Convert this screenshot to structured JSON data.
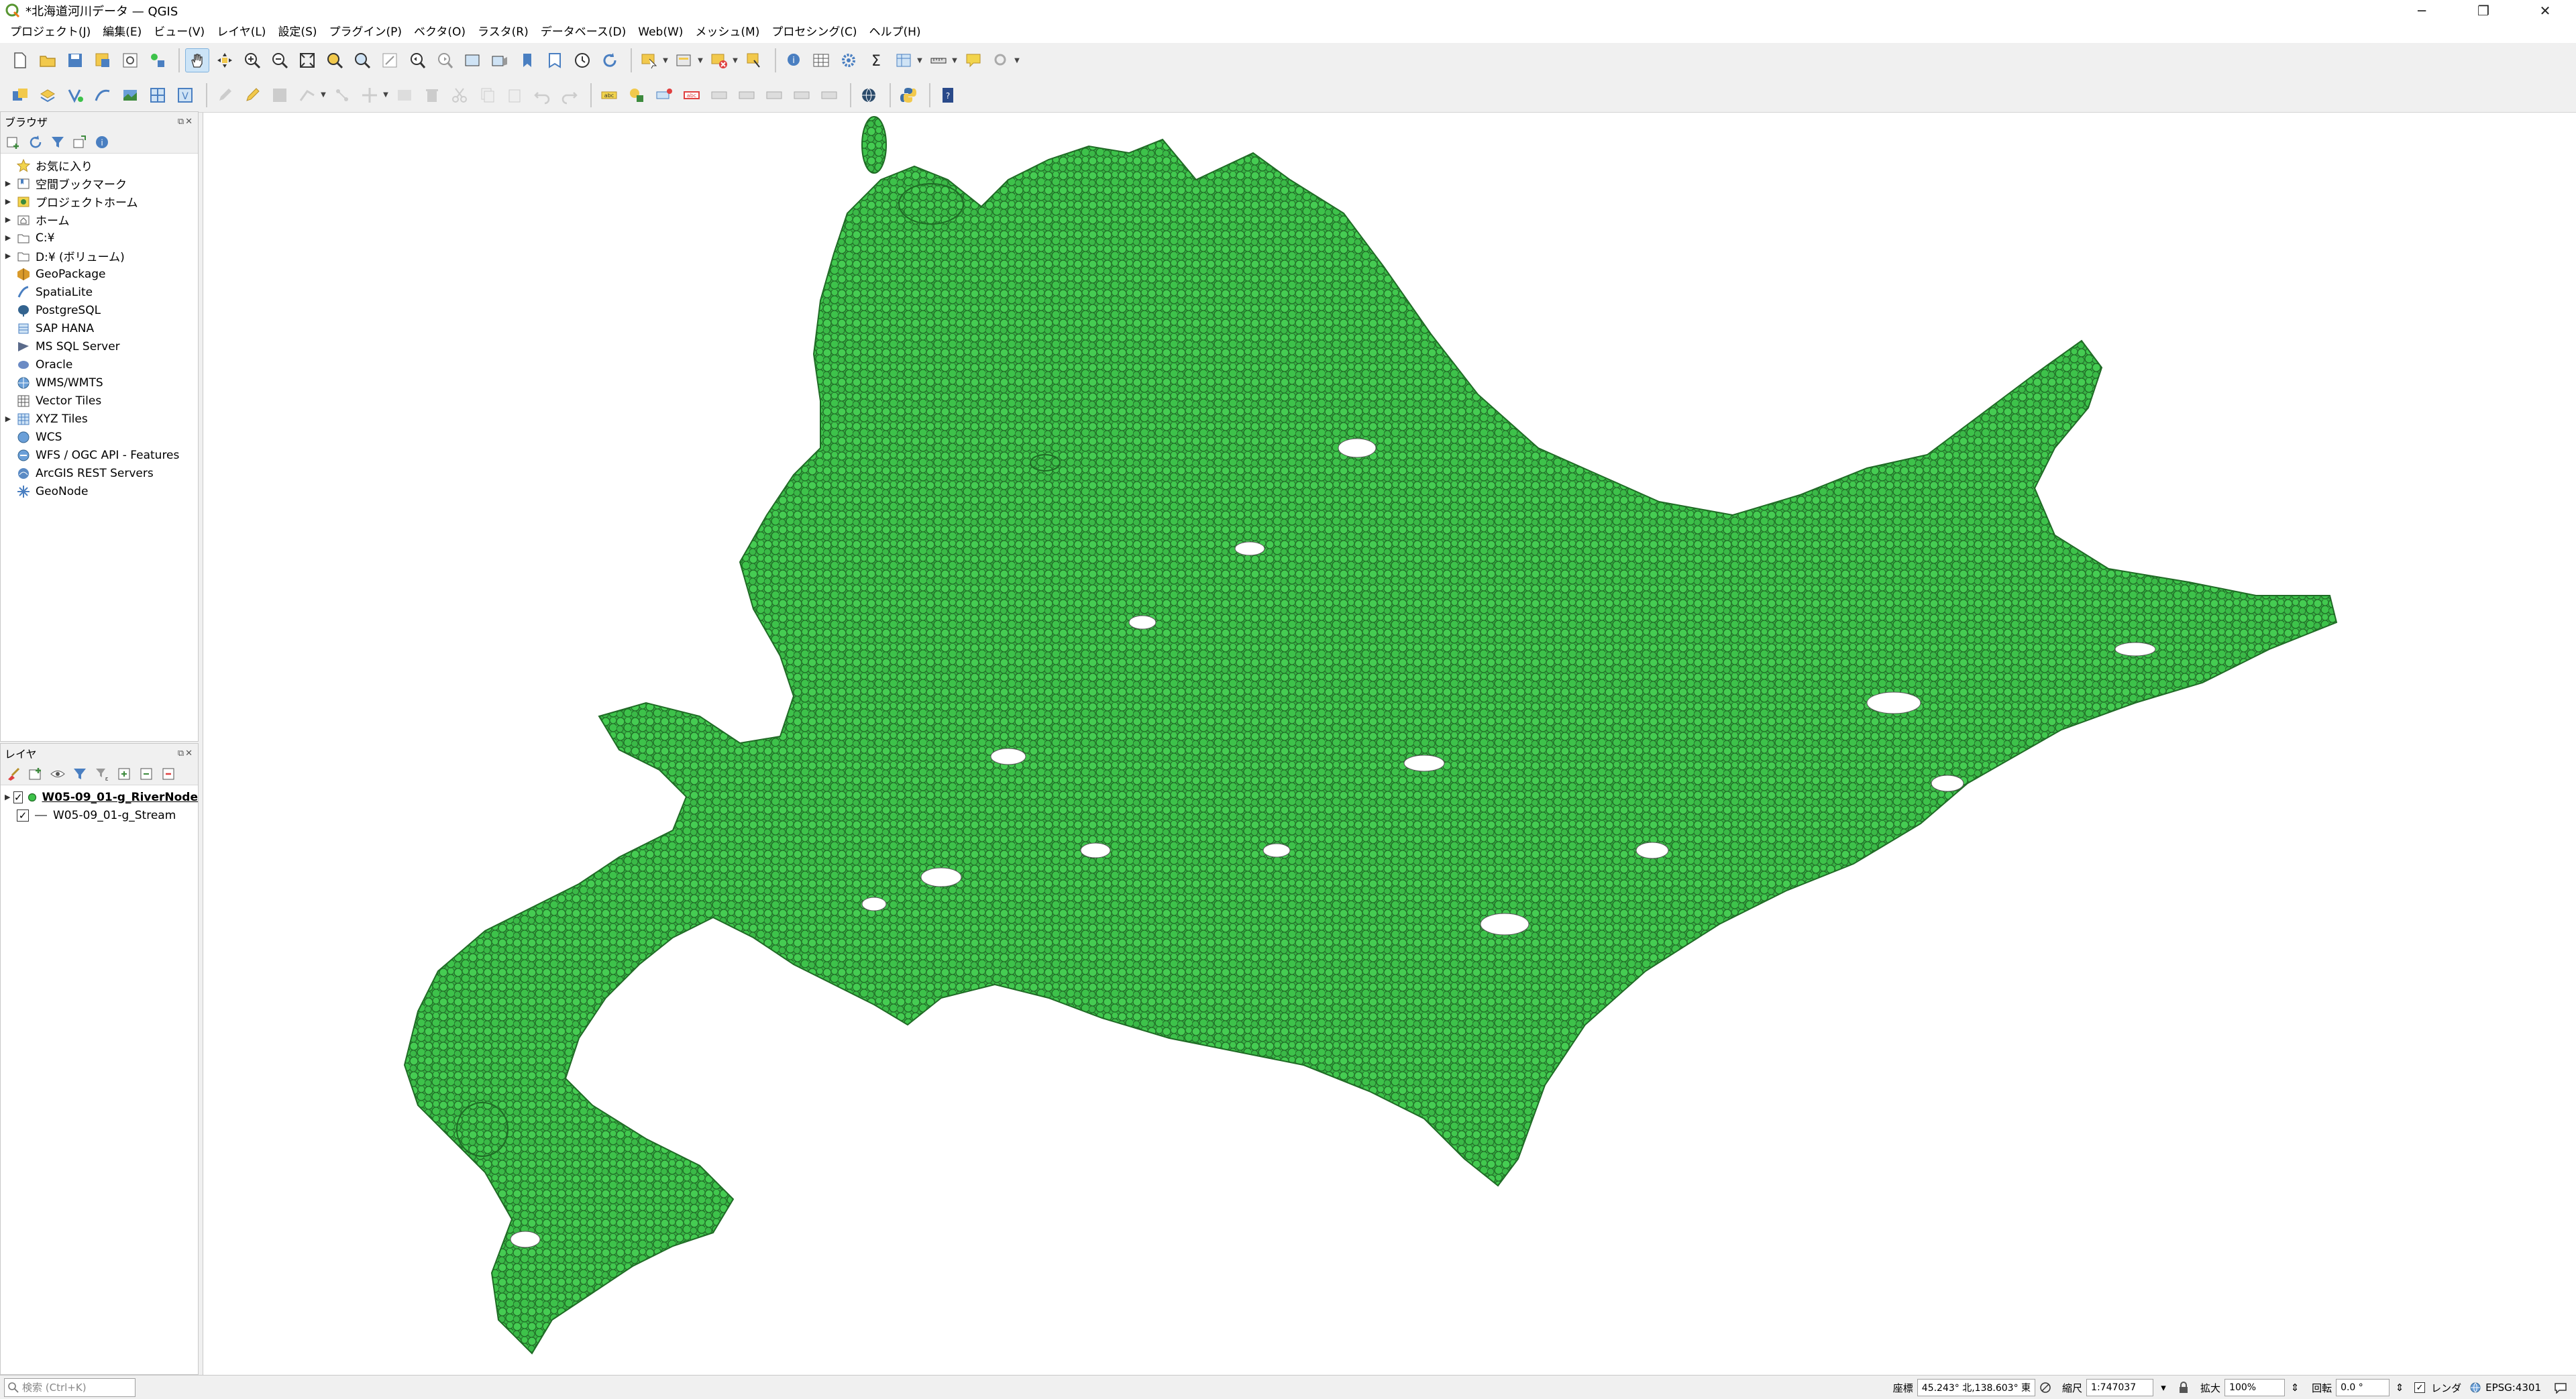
{
  "window": {
    "title": "*北海道河川データ — QGIS",
    "minimize": "─",
    "restore": "❐",
    "close": "✕"
  },
  "menus": [
    "プロジェクト(J)",
    "編集(E)",
    "ビュー(V)",
    "レイヤ(L)",
    "設定(S)",
    "プラグイン(P)",
    "ベクタ(O)",
    "ラスタ(R)",
    "データベース(D)",
    "Web(W)",
    "メッシュ(M)",
    "プロセシング(C)",
    "ヘルプ(H)"
  ],
  "browser": {
    "title": "ブラウザ",
    "items": [
      {
        "label": "お気に入り",
        "icon": "star-icon",
        "expandable": false
      },
      {
        "label": "空間ブックマーク",
        "icon": "bookmark-icon",
        "expandable": true
      },
      {
        "label": "プロジェクトホーム",
        "icon": "project-home-icon",
        "expandable": true
      },
      {
        "label": "ホーム",
        "icon": "home-folder-icon",
        "expandable": true
      },
      {
        "label": "C:¥",
        "icon": "drive-icon",
        "expandable": true
      },
      {
        "label": "D:¥ (ボリューム)",
        "icon": "drive-icon",
        "expandable": true
      },
      {
        "label": "GeoPackage",
        "icon": "geopackage-icon",
        "expandable": false
      },
      {
        "label": "SpatiaLite",
        "icon": "spatialite-icon",
        "expandable": false
      },
      {
        "label": "PostgreSQL",
        "icon": "postgresql-icon",
        "expandable": false
      },
      {
        "label": "SAP HANA",
        "icon": "sap-hana-icon",
        "expandable": false
      },
      {
        "label": "MS SQL Server",
        "icon": "mssql-icon",
        "expandable": false
      },
      {
        "label": "Oracle",
        "icon": "oracle-icon",
        "expandable": false
      },
      {
        "label": "WMS/WMTS",
        "icon": "wms-icon",
        "expandable": false
      },
      {
        "label": "Vector Tiles",
        "icon": "vector-tiles-icon",
        "expandable": false
      },
      {
        "label": "XYZ Tiles",
        "icon": "xyz-tiles-icon",
        "expandable": true
      },
      {
        "label": "WCS",
        "icon": "wcs-icon",
        "expandable": false
      },
      {
        "label": "WFS / OGC API - Features",
        "icon": "wfs-icon",
        "expandable": false
      },
      {
        "label": "ArcGIS REST Servers",
        "icon": "arcgis-icon",
        "expandable": false
      },
      {
        "label": "GeoNode",
        "icon": "geonode-icon",
        "expandable": false
      }
    ]
  },
  "layers": {
    "title": "レイヤ",
    "items": [
      {
        "name": "W05-09_01-g_RiverNode",
        "checked": true,
        "symbol": "point",
        "selected": true
      },
      {
        "name": "W05-09_01-g_Stream",
        "checked": true,
        "symbol": "line",
        "selected": false
      }
    ]
  },
  "status": {
    "search_placeholder": "検索 (Ctrl+K)",
    "coord_label": "座標",
    "coord_value": "45.243° 北,138.603° 東",
    "scale_label": "縮尺",
    "scale_value": "1:747037",
    "magnifier_label": "拡大",
    "magnifier_value": "100%",
    "rotation_label": "回転",
    "rotation_value": "0.0 °",
    "render_label": "レンダ",
    "crs": "EPSG:4301"
  },
  "colors": {
    "point_fill": "#3dc24a",
    "point_stroke": "#1f6b25",
    "land": "#38b545"
  }
}
